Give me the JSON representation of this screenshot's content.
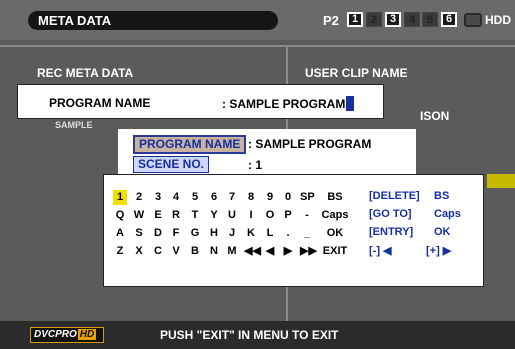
{
  "header": {
    "title": "META DATA",
    "media_label": "P2",
    "slots": [
      {
        "label": "1",
        "active": true
      },
      {
        "label": "2",
        "active": false
      },
      {
        "label": "3",
        "active": true
      },
      {
        "label": "4",
        "active": false
      },
      {
        "label": "5",
        "active": false
      },
      {
        "label": "6",
        "active": true
      }
    ],
    "hdd_label": "HDD"
  },
  "background": {
    "left_heading": "REC META DATA",
    "left_sub": "SAMPLE",
    "right_heading": "USER CLIP NAME",
    "right_sub": "ISON"
  },
  "dialog": {
    "label": "PROGRAM NAME",
    "value": ": SAMPLE PROGRAM"
  },
  "fields": [
    {
      "label": "PROGRAM NAME",
      "value": ":  SAMPLE PROGRAM",
      "selected": true
    },
    {
      "label": "SCENE NO.",
      "value": ":  1",
      "selected": false
    }
  ],
  "keyboard": {
    "rows": [
      [
        "1",
        "2",
        "3",
        "4",
        "5",
        "6",
        "7",
        "8",
        "9",
        "0",
        "SP",
        "BS"
      ],
      [
        "Q",
        "W",
        "E",
        "R",
        "T",
        "Y",
        "U",
        "I",
        "O",
        "P",
        "-",
        "Caps"
      ],
      [
        "A",
        "S",
        "D",
        "F",
        "G",
        "H",
        "J",
        "K",
        "L",
        ".",
        "_",
        "OK"
      ],
      [
        "Z",
        "X",
        "C",
        "V",
        "B",
        "N",
        "M",
        "◀◀",
        "◀",
        "▶",
        "▶▶",
        "EXIT"
      ]
    ],
    "selected_key": "1",
    "help": [
      {
        "key": "[DELETE]",
        "action": "BS"
      },
      {
        "key": "[GO TO]",
        "action": "Caps"
      },
      {
        "key": "[ENTRY]",
        "action": "OK"
      },
      {
        "key": "[-] ◀",
        "action": "[+] ▶"
      }
    ]
  },
  "footer": {
    "logo_text": "DVCPRO",
    "logo_hd": "HD",
    "message": "PUSH \"EXIT\" IN MENU TO EXIT"
  }
}
